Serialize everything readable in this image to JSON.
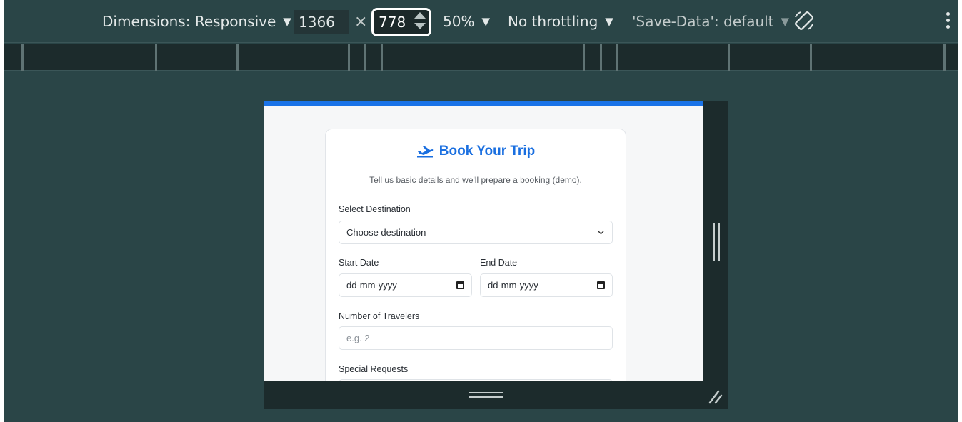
{
  "toolbar": {
    "dimensions_label": "Dimensions: Responsive",
    "width_value": "1366",
    "times": "×",
    "height_value": "778",
    "zoom_label": "50%",
    "throttling_label": "No throttling",
    "save_data_label": "'Save-Data': default",
    "dropdown_arrow": "▼"
  },
  "form": {
    "title": "Book Your Trip",
    "subtitle": "Tell us basic details and we'll prepare a booking (demo).",
    "destination_label": "Select Destination",
    "destination_value": "Choose destination",
    "start_date_label": "Start Date",
    "start_date_value": "dd-mm-yyyy",
    "end_date_label": "End Date",
    "end_date_value": "dd-mm-yyyy",
    "travelers_label": "Number of Travelers",
    "travelers_placeholder": "e.g. 2",
    "requests_label": "Special Requests"
  },
  "colors": {
    "accent": "#1a73e8",
    "toolbar_bg": "#2a4547",
    "ruler_bg": "#1c2b2c"
  },
  "icons": [
    "chevron-down-icon",
    "calendar-icon",
    "airplane-icon",
    "rotate-icon",
    "more-vertical-icon",
    "resize-handle-icon"
  ]
}
